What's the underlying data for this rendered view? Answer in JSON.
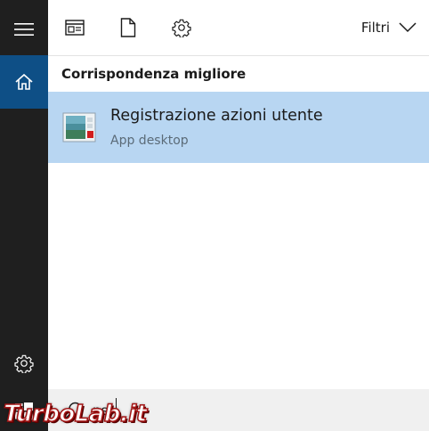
{
  "colors": {
    "rail_bg": "#1f1f1f",
    "rail_active": "#0e4f86",
    "selection": "#b8d6f2",
    "search_bg": "#f0f0f0"
  },
  "rail": {
    "menu_icon": "hamburger-icon",
    "home_icon": "home-icon",
    "settings_icon": "gear-icon",
    "start_icon": "windows-logo-icon"
  },
  "toolbar": {
    "icons": [
      "layout-icon",
      "document-icon",
      "gear-icon"
    ],
    "filter_label": "Filtri"
  },
  "results": {
    "section_title": "Corrispondenza migliore",
    "best_match": {
      "title": "Registrazione azioni utente",
      "subtitle": "App desktop"
    }
  },
  "search": {
    "value": "psr",
    "placeholder": ""
  },
  "watermark": {
    "text": "TurboLab.it"
  }
}
